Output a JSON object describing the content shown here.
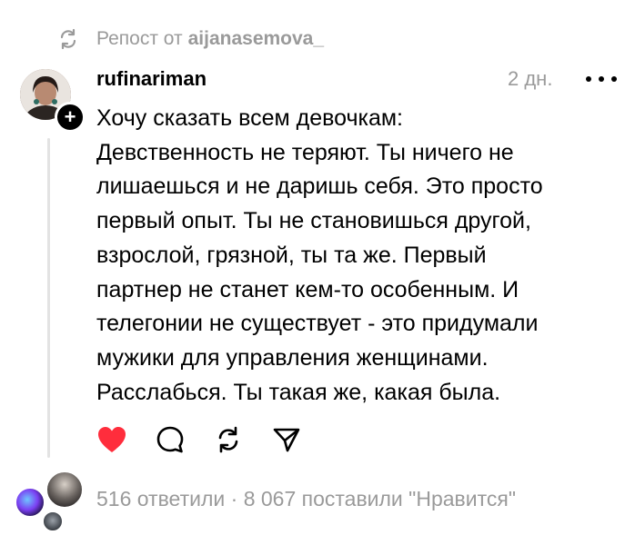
{
  "repost": {
    "icon": "repost-icon",
    "prefix": "Репост от",
    "author": "aijanasemova_"
  },
  "post": {
    "username": "rufinariman",
    "time": "2 дн.",
    "follow_icon": "plus-icon",
    "more_icon": "more-dots-icon",
    "lines": [
      "Хочу сказать всем девочкам:",
      "Девственность не теряют. Ты ничего не",
      "лишаешься и не даришь себя. Это просто",
      "первый опыт. Ты не становишься другой,",
      "взрослой, грязной, ты та же. Первый",
      "партнер не станет кем-то особенным. И",
      "телегонии не существует - это придумали",
      "мужики для управления женщинами.",
      "Расслабься. Ты такая же, какая была."
    ]
  },
  "actions": {
    "like_icon": "heart-icon",
    "liked": true,
    "like_color": "#ff2d3c",
    "reply_icon": "comment-icon",
    "repost_icon": "repost-icon",
    "share_icon": "send-icon"
  },
  "stats": {
    "replies": "516 ответили",
    "separator": "·",
    "likes": "8 067 поставили \"Нравится\""
  }
}
